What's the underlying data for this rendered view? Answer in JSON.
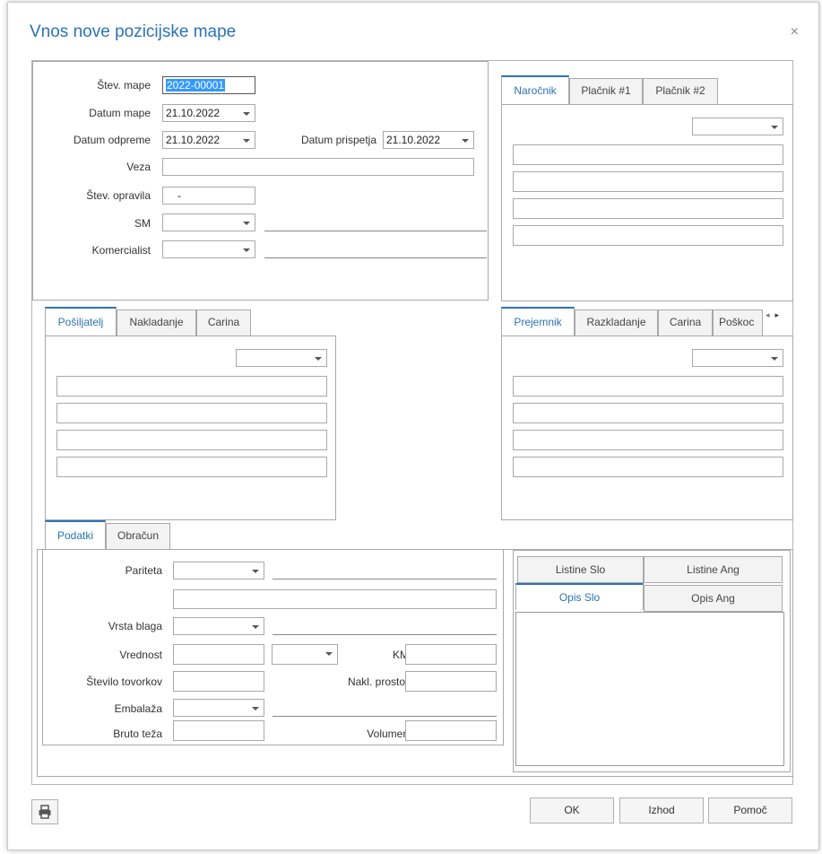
{
  "dialog": {
    "title": "Vnos nove pozicijske mape",
    "close": "×"
  },
  "header_form": {
    "stev_mape": {
      "label": "Štev. mape",
      "value": "2022-00001"
    },
    "datum_mape": {
      "label": "Datum mape",
      "value": "21.10.2022"
    },
    "datum_odpreme": {
      "label": "Datum odpreme",
      "value": "21.10.2022"
    },
    "datum_prispetja": {
      "label": "Datum prispetja",
      "value": "21.10.2022"
    },
    "veza": {
      "label": "Veza",
      "value": ""
    },
    "stev_opravila": {
      "label": "Štev. opravila",
      "value": "-"
    },
    "sm": {
      "label": "SM",
      "value": ""
    },
    "komercialist": {
      "label": "Komercialist",
      "value": ""
    }
  },
  "client_tabs": [
    "Naročnik",
    "Plačnik #1",
    "Plačnik #2"
  ],
  "sender_tabs": [
    "Pošiljatelj",
    "Nakladanje",
    "Carina"
  ],
  "receiver_tabs": [
    "Prejemnik",
    "Razkladanje",
    "Carina",
    "Poškoc"
  ],
  "bottom_tabs": [
    "Podatki",
    "Obračun"
  ],
  "podatki": {
    "pariteta": {
      "label": "Pariteta",
      "value": ""
    },
    "vrsta_blaga": {
      "label": "Vrsta blaga",
      "value": ""
    },
    "vrednost": {
      "label": "Vrednost",
      "value": ""
    },
    "km": {
      "label": "KM",
      "value": ""
    },
    "stevilo_tovorkov": {
      "label": "Število tovorkov",
      "value": ""
    },
    "nakl_prostor": {
      "label": "Nakl. prostor",
      "value": ""
    },
    "embalaza": {
      "label": "Embalaža",
      "value": ""
    },
    "bruto_teza": {
      "label": "Bruto teža",
      "value": ""
    },
    "volumen": {
      "label": "Volumen",
      "value": ""
    }
  },
  "doc_tabs": {
    "row1": [
      "Listine Slo",
      "Listine Ang"
    ],
    "row2": [
      "Opis Slo",
      "Opis Ang"
    ]
  },
  "footer": {
    "ok": "OK",
    "izhod": "Izhod",
    "pomoc": "Pomoč",
    "print_icon": "printer-icon"
  },
  "colors": {
    "accent": "#2b73b5",
    "selection": "#3399ff"
  }
}
